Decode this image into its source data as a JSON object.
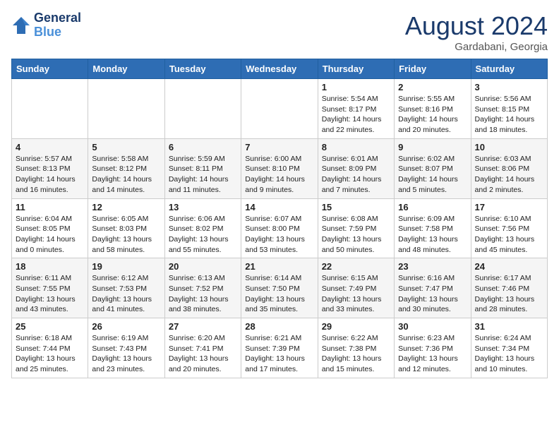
{
  "header": {
    "logo_line1": "General",
    "logo_line2": "Blue",
    "month": "August 2024",
    "location": "Gardabani, Georgia"
  },
  "days_of_week": [
    "Sunday",
    "Monday",
    "Tuesday",
    "Wednesday",
    "Thursday",
    "Friday",
    "Saturday"
  ],
  "weeks": [
    [
      {
        "day": "",
        "info": ""
      },
      {
        "day": "",
        "info": ""
      },
      {
        "day": "",
        "info": ""
      },
      {
        "day": "",
        "info": ""
      },
      {
        "day": "1",
        "info": "Sunrise: 5:54 AM\nSunset: 8:17 PM\nDaylight: 14 hours\nand 22 minutes."
      },
      {
        "day": "2",
        "info": "Sunrise: 5:55 AM\nSunset: 8:16 PM\nDaylight: 14 hours\nand 20 minutes."
      },
      {
        "day": "3",
        "info": "Sunrise: 5:56 AM\nSunset: 8:15 PM\nDaylight: 14 hours\nand 18 minutes."
      }
    ],
    [
      {
        "day": "4",
        "info": "Sunrise: 5:57 AM\nSunset: 8:13 PM\nDaylight: 14 hours\nand 16 minutes."
      },
      {
        "day": "5",
        "info": "Sunrise: 5:58 AM\nSunset: 8:12 PM\nDaylight: 14 hours\nand 14 minutes."
      },
      {
        "day": "6",
        "info": "Sunrise: 5:59 AM\nSunset: 8:11 PM\nDaylight: 14 hours\nand 11 minutes."
      },
      {
        "day": "7",
        "info": "Sunrise: 6:00 AM\nSunset: 8:10 PM\nDaylight: 14 hours\nand 9 minutes."
      },
      {
        "day": "8",
        "info": "Sunrise: 6:01 AM\nSunset: 8:09 PM\nDaylight: 14 hours\nand 7 minutes."
      },
      {
        "day": "9",
        "info": "Sunrise: 6:02 AM\nSunset: 8:07 PM\nDaylight: 14 hours\nand 5 minutes."
      },
      {
        "day": "10",
        "info": "Sunrise: 6:03 AM\nSunset: 8:06 PM\nDaylight: 14 hours\nand 2 minutes."
      }
    ],
    [
      {
        "day": "11",
        "info": "Sunrise: 6:04 AM\nSunset: 8:05 PM\nDaylight: 14 hours\nand 0 minutes."
      },
      {
        "day": "12",
        "info": "Sunrise: 6:05 AM\nSunset: 8:03 PM\nDaylight: 13 hours\nand 58 minutes."
      },
      {
        "day": "13",
        "info": "Sunrise: 6:06 AM\nSunset: 8:02 PM\nDaylight: 13 hours\nand 55 minutes."
      },
      {
        "day": "14",
        "info": "Sunrise: 6:07 AM\nSunset: 8:00 PM\nDaylight: 13 hours\nand 53 minutes."
      },
      {
        "day": "15",
        "info": "Sunrise: 6:08 AM\nSunset: 7:59 PM\nDaylight: 13 hours\nand 50 minutes."
      },
      {
        "day": "16",
        "info": "Sunrise: 6:09 AM\nSunset: 7:58 PM\nDaylight: 13 hours\nand 48 minutes."
      },
      {
        "day": "17",
        "info": "Sunrise: 6:10 AM\nSunset: 7:56 PM\nDaylight: 13 hours\nand 45 minutes."
      }
    ],
    [
      {
        "day": "18",
        "info": "Sunrise: 6:11 AM\nSunset: 7:55 PM\nDaylight: 13 hours\nand 43 minutes."
      },
      {
        "day": "19",
        "info": "Sunrise: 6:12 AM\nSunset: 7:53 PM\nDaylight: 13 hours\nand 41 minutes."
      },
      {
        "day": "20",
        "info": "Sunrise: 6:13 AM\nSunset: 7:52 PM\nDaylight: 13 hours\nand 38 minutes."
      },
      {
        "day": "21",
        "info": "Sunrise: 6:14 AM\nSunset: 7:50 PM\nDaylight: 13 hours\nand 35 minutes."
      },
      {
        "day": "22",
        "info": "Sunrise: 6:15 AM\nSunset: 7:49 PM\nDaylight: 13 hours\nand 33 minutes."
      },
      {
        "day": "23",
        "info": "Sunrise: 6:16 AM\nSunset: 7:47 PM\nDaylight: 13 hours\nand 30 minutes."
      },
      {
        "day": "24",
        "info": "Sunrise: 6:17 AM\nSunset: 7:46 PM\nDaylight: 13 hours\nand 28 minutes."
      }
    ],
    [
      {
        "day": "25",
        "info": "Sunrise: 6:18 AM\nSunset: 7:44 PM\nDaylight: 13 hours\nand 25 minutes."
      },
      {
        "day": "26",
        "info": "Sunrise: 6:19 AM\nSunset: 7:43 PM\nDaylight: 13 hours\nand 23 minutes."
      },
      {
        "day": "27",
        "info": "Sunrise: 6:20 AM\nSunset: 7:41 PM\nDaylight: 13 hours\nand 20 minutes."
      },
      {
        "day": "28",
        "info": "Sunrise: 6:21 AM\nSunset: 7:39 PM\nDaylight: 13 hours\nand 17 minutes."
      },
      {
        "day": "29",
        "info": "Sunrise: 6:22 AM\nSunset: 7:38 PM\nDaylight: 13 hours\nand 15 minutes."
      },
      {
        "day": "30",
        "info": "Sunrise: 6:23 AM\nSunset: 7:36 PM\nDaylight: 13 hours\nand 12 minutes."
      },
      {
        "day": "31",
        "info": "Sunrise: 6:24 AM\nSunset: 7:34 PM\nDaylight: 13 hours\nand 10 minutes."
      }
    ]
  ]
}
